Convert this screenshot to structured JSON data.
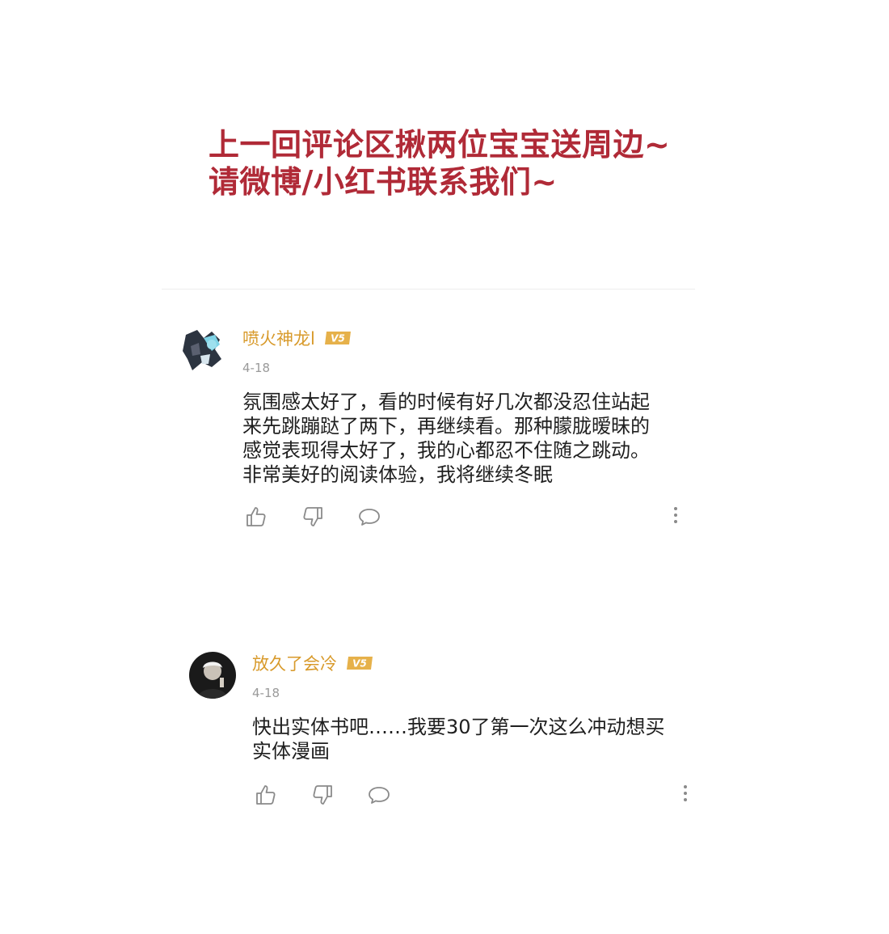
{
  "headline": {
    "line1": "上一回评论区揪两位宝宝送周边~",
    "line2": "请微博/小红书联系我们~"
  },
  "colors": {
    "headline": "#b02a37",
    "username": "#d89a2b",
    "vip_badge": "#e6b14a",
    "date": "#9a9a9a",
    "icon": "#8a8a8a"
  },
  "comments": [
    {
      "username": "喷火神龙l",
      "badge": "V5",
      "date": "4-18",
      "lines": [
        "氛围感太好了，看的时候有好几次都没忍住站起",
        "来先跳蹦跶了两下，再继续看。那种朦胧暧昧的",
        "感觉表现得太好了，我的心都忍不住随之跳动。",
        "非常美好的阅读体验，我将继续冬眠"
      ],
      "icons": [
        "thumbs-up-icon",
        "thumbs-down-icon",
        "comment-bubble-icon",
        "more-vertical-icon"
      ]
    },
    {
      "username": "放久了会冷",
      "badge": "V5",
      "date": "4-18",
      "lines": [
        "快出实体书吧……我要30了第一次这么冲动想买",
        "实体漫画"
      ],
      "icons": [
        "thumbs-up-icon",
        "thumbs-down-icon",
        "comment-bubble-icon",
        "more-vertical-icon"
      ]
    }
  ]
}
